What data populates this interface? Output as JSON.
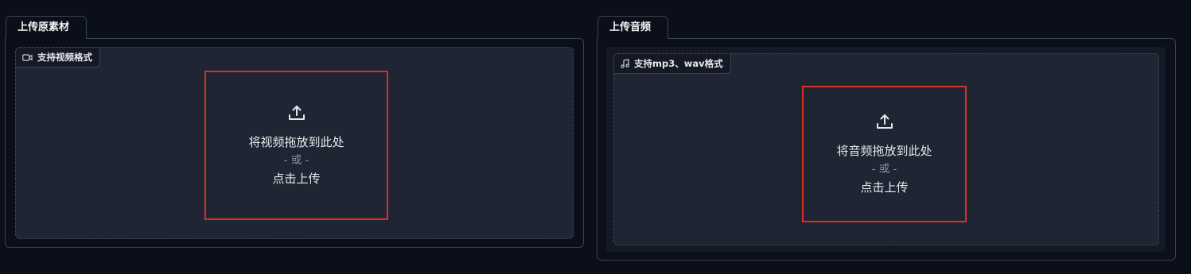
{
  "video_panel": {
    "tab_label": "上传原素材",
    "badge_icon": "video-camera-icon",
    "badge_text": "支持视频格式",
    "upload_icon": "upload-icon",
    "drop_text": "将视频拖放到此处",
    "or_text": "- 或 -",
    "click_text": "点击上传"
  },
  "audio_panel": {
    "tab_label": "上传音频",
    "badge_icon": "music-note-icon",
    "badge_text": "支持mp3、wav格式",
    "upload_icon": "upload-icon",
    "drop_text": "将音频拖放到此处",
    "or_text": "- 或 -",
    "click_text": "点击上传"
  },
  "colors": {
    "background": "#0b0f19",
    "dropzone": "#1f2532",
    "highlight_border": "#d93025"
  }
}
